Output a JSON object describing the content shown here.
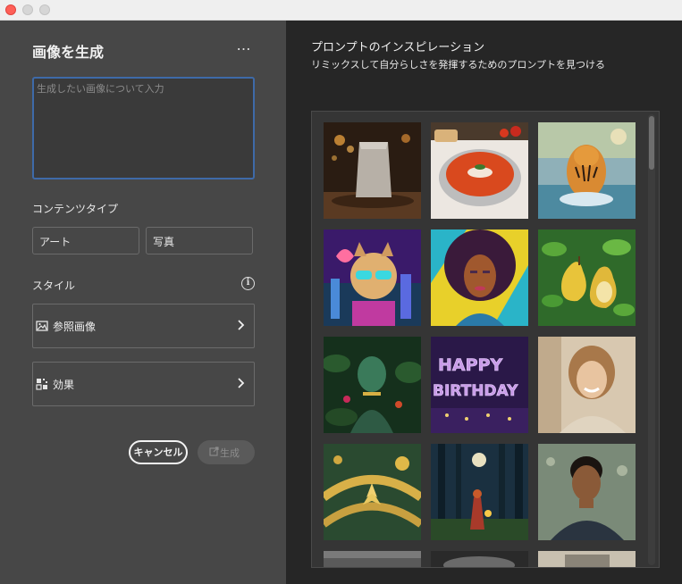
{
  "window": {
    "close": "close",
    "minimize": "minimize",
    "maximize": "maximize"
  },
  "left": {
    "title": "画像を生成",
    "more_icon": "…",
    "prompt": {
      "value": "",
      "placeholder": "生成したい画像について入力"
    },
    "content_type": {
      "label": "コンテンツタイプ",
      "options": [
        "アート",
        "写真"
      ]
    },
    "style": {
      "label": "スタイル",
      "info_icon": "i",
      "reference_label": "参照画像",
      "effects_label": "効果"
    },
    "cancel_label": "キャンセル",
    "generate_label": "生成"
  },
  "right": {
    "title": "プロンプトのインスピレーション",
    "subtitle": "リミックスして自分らしさを発揮するためのプロンプトを見つける",
    "thumbnails": [
      "coffee-bag",
      "tomato-soup",
      "tiger-in-water",
      "pop-art-dog",
      "afro-woman-portrait",
      "pears",
      "jungle-statue",
      "happy-birthday-balloons",
      "smiling-woman-portrait",
      "golden-lotus",
      "girl-with-lantern-forest",
      "man-portrait-rain"
    ]
  },
  "colors": {
    "accent_focus": "#3e6aa8",
    "left_bg": "#474747",
    "right_bg": "#262626"
  }
}
